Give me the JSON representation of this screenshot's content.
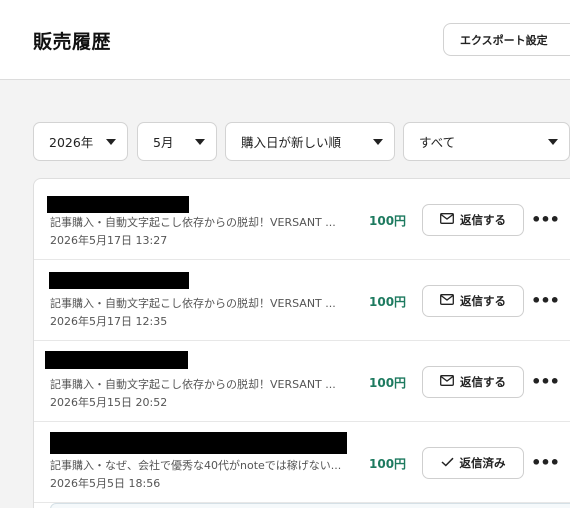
{
  "header": {
    "title": "販売履歴",
    "export_label": "エクスポート設定"
  },
  "filters": {
    "year": "2026年",
    "month": "5月",
    "sort": "購入日が新しい順",
    "type": "すべて"
  },
  "sales": [
    {
      "title": "記事購入・自動文字起こし依存からの脱却！VERSANT ...",
      "date": "2026年5月17日 13:27",
      "price": "100円",
      "action_label": "返信する",
      "action_icon": "mail-icon"
    },
    {
      "title": "記事購入・自動文字起こし依存からの脱却！VERSANT ...",
      "date": "2026年5月17日 12:35",
      "price": "100円",
      "action_label": "返信する",
      "action_icon": "mail-icon"
    },
    {
      "title": "記事購入・自動文字起こし依存からの脱却！VERSANT ...",
      "date": "2026年5月15日 20:52",
      "price": "100円",
      "action_label": "返信する",
      "action_icon": "mail-icon"
    },
    {
      "title": "記事購入・なぜ、会社で優秀な40代がnoteでは稼げない...",
      "date": "2026年5月5日 18:56",
      "price": "100円",
      "action_label": "返信済み",
      "action_icon": "check-icon"
    }
  ],
  "more_glyph": "•••",
  "colors": {
    "price": "#1d7a5f",
    "background": "#f3f3f3"
  }
}
